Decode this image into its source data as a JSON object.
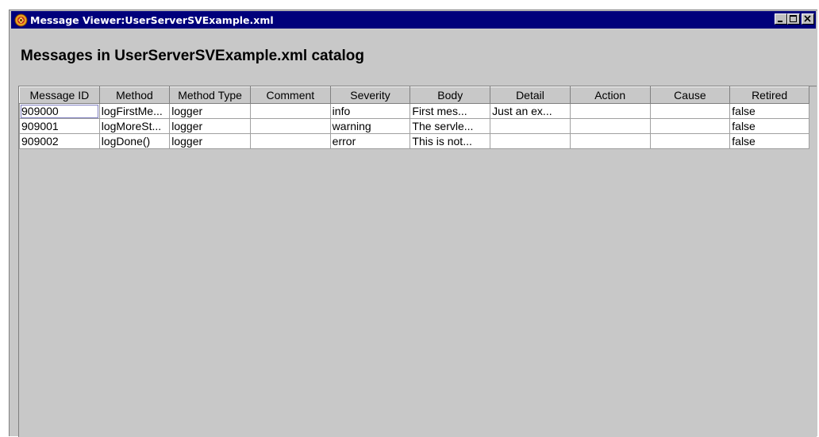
{
  "window": {
    "title": "Message Viewer:UserServerSVExample.xml",
    "app_icon": "message-viewer-app-icon",
    "controls": [
      "minimize-icon",
      "maximize-icon",
      "close-icon"
    ]
  },
  "heading": "Messages in UserServerSVExample.xml catalog",
  "table": {
    "columns": [
      "Message ID",
      "Method",
      "Method Type",
      "Comment",
      "Severity",
      "Body",
      "Detail",
      "Action",
      "Cause",
      "Retired"
    ],
    "rows": [
      [
        "909000",
        "logFirstMe...",
        "logger",
        "",
        "info",
        "First mes...",
        "Just an ex...",
        "",
        "",
        "false"
      ],
      [
        "909001",
        "logMoreSt...",
        "logger",
        "",
        "warning",
        "The servle...",
        "",
        "",
        "",
        "false"
      ],
      [
        "909002",
        "logDone()",
        "logger",
        "",
        "error",
        "This is not...",
        "",
        "",
        "",
        "false"
      ]
    ]
  },
  "colors": {
    "titlebar": "#00007b",
    "window_bg": "#c8c8c8",
    "cell_bg": "#ffffff"
  }
}
